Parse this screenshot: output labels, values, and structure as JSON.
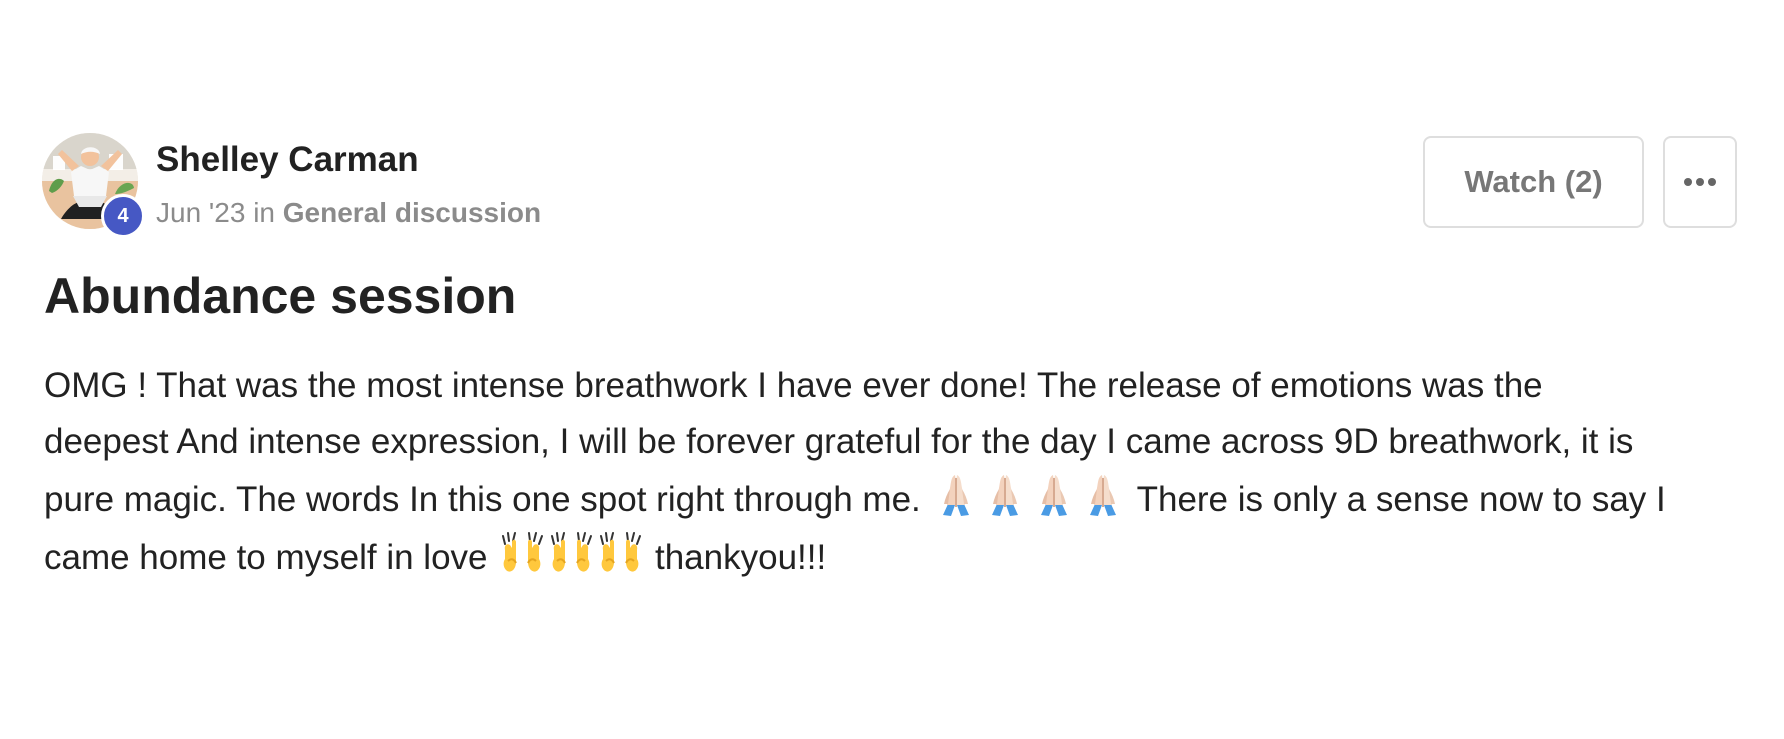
{
  "post": {
    "author": {
      "name": "Shelley Carman",
      "level": "4"
    },
    "meta": {
      "date": "Jun '23",
      "in_word": "in",
      "category": "General discussion"
    },
    "actions": {
      "watch_label": "Watch (2)",
      "more_icon": "more-horizontal-icon"
    },
    "title": "Abundance session",
    "body": {
      "line_1": "OMG ! That was the most intense breathwork I have ever done! The release of emotions was the",
      "line_2": "deepest And intense expression, I will be forever grateful for the day I came across 9D breathwork, it is",
      "line_3_start": "pure magic. The words In this one spot right through me.",
      "line_3_end": "There is only a sense now to say I",
      "line_4_start": "came home to myself in love",
      "line_4_end": "thankyou!!!"
    },
    "emojis": {
      "praying_hands": {
        "icon": "praying-hands-icon",
        "glyph": "🙏🏻",
        "count": 4
      },
      "raising_hands": {
        "icon": "raising-hands-icon",
        "glyph": "🙌",
        "count": 3
      }
    },
    "colors": {
      "badge": "#4658c4",
      "text": "#222222",
      "muted": "#8b8b8b",
      "border": "#dedede"
    }
  }
}
